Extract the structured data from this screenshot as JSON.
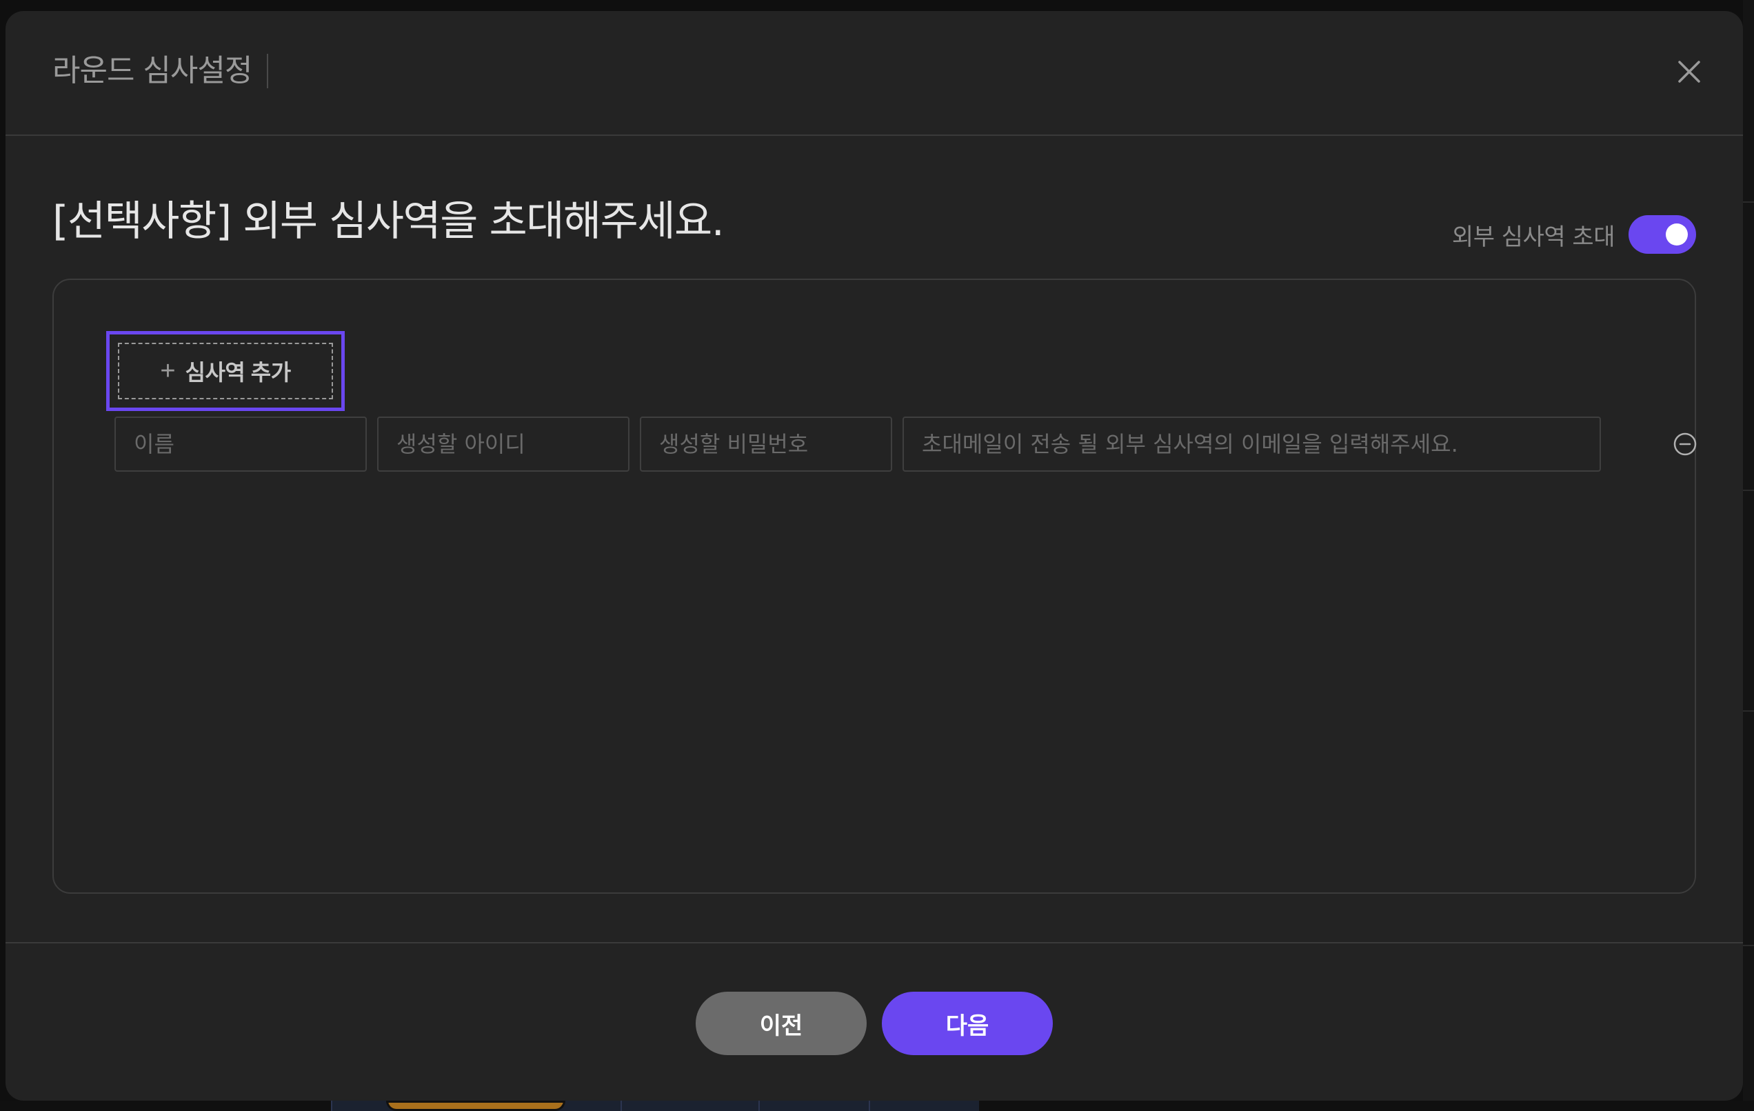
{
  "modal": {
    "title": "라운드 심사설정",
    "close_icon": "close-icon"
  },
  "section": {
    "title": "[선택사항] 외부 심사역을 초대해주세요.",
    "toggle_label": "외부 심사역 초대",
    "toggle_on": true,
    "accent_color": "#6a47f0"
  },
  "add_button": {
    "icon": "plus-icon",
    "label": "심사역 추가"
  },
  "reviewer_row": {
    "name_placeholder": "이름",
    "id_placeholder": "생성할 아이디",
    "password_placeholder": "생성할 비밀번호",
    "email_placeholder": "초대메일이 전송 될 외부 심사역의 이메일을 입력해주세요.",
    "name_value": "",
    "id_value": "",
    "password_value": "",
    "email_value": "",
    "remove_icon": "minus-circle-icon"
  },
  "footer": {
    "prev_label": "이전",
    "next_label": "다음"
  }
}
